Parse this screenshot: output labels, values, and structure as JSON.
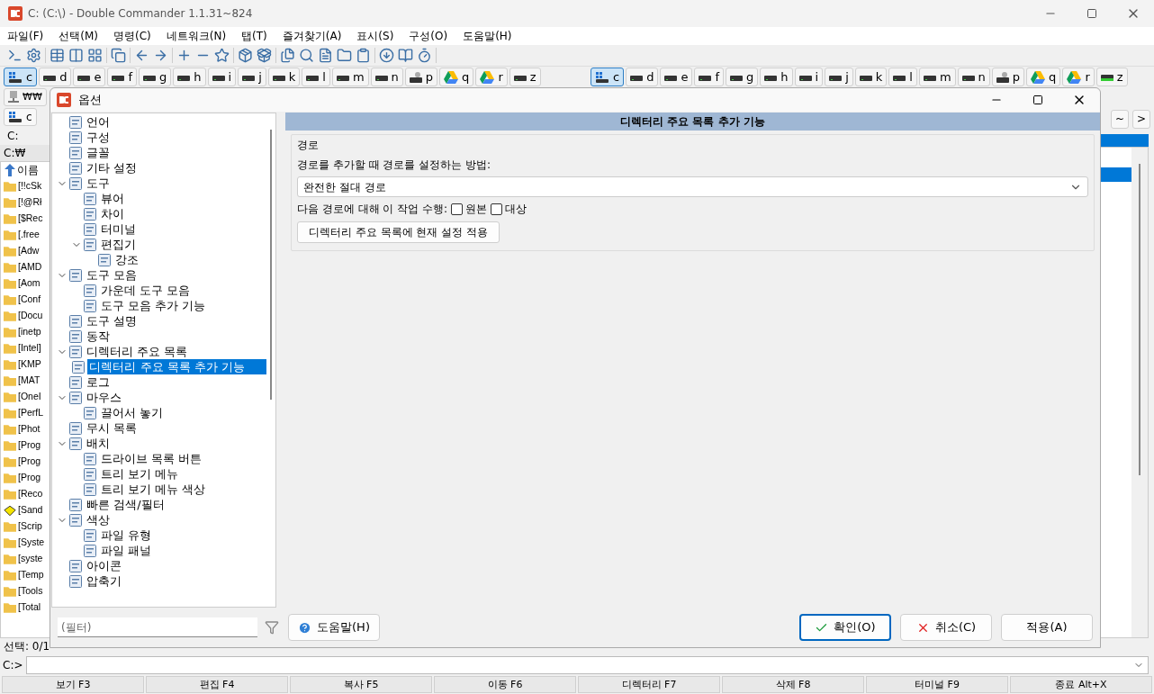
{
  "window": {
    "title": "C: (C:\\) - Double Commander 1.1.31~824"
  },
  "menu": [
    "파일(F)",
    "선택(M)",
    "명령(C)",
    "네트워크(N)",
    "탭(T)",
    "즐겨찾기(A)",
    "표시(S)",
    "구성(O)",
    "도움말(H)"
  ],
  "drives_left": [
    {
      "label": "c",
      "kind": "system",
      "selected": true
    },
    {
      "label": "d",
      "kind": "disk",
      "selected": false
    },
    {
      "label": "e",
      "kind": "disk",
      "selected": false
    },
    {
      "label": "f",
      "kind": "disk",
      "selected": false
    },
    {
      "label": "g",
      "kind": "disk",
      "selected": false
    },
    {
      "label": "h",
      "kind": "disk",
      "selected": false
    },
    {
      "label": "i",
      "kind": "disk",
      "selected": false
    },
    {
      "label": "j",
      "kind": "disk",
      "selected": false
    },
    {
      "label": "k",
      "kind": "disk",
      "selected": false
    },
    {
      "label": "l",
      "kind": "disk",
      "selected": false
    },
    {
      "label": "m",
      "kind": "disk",
      "selected": false
    },
    {
      "label": "n",
      "kind": "disk",
      "selected": false
    },
    {
      "label": "p",
      "kind": "network",
      "selected": false
    },
    {
      "label": "q",
      "kind": "cloud",
      "selected": false
    },
    {
      "label": "r",
      "kind": "cloud",
      "selected": false
    },
    {
      "label": "z",
      "kind": "disk",
      "selected": false
    }
  ],
  "drives_right": [
    {
      "label": "c",
      "kind": "system",
      "selected": true
    },
    {
      "label": "d",
      "kind": "disk",
      "selected": false
    },
    {
      "label": "e",
      "kind": "disk",
      "selected": false
    },
    {
      "label": "f",
      "kind": "disk",
      "selected": false
    },
    {
      "label": "g",
      "kind": "disk",
      "selected": false
    },
    {
      "label": "h",
      "kind": "disk",
      "selected": false
    },
    {
      "label": "i",
      "kind": "disk",
      "selected": false
    },
    {
      "label": "j",
      "kind": "disk",
      "selected": false
    },
    {
      "label": "k",
      "kind": "disk",
      "selected": false
    },
    {
      "label": "l",
      "kind": "disk",
      "selected": false
    },
    {
      "label": "m",
      "kind": "disk",
      "selected": false
    },
    {
      "label": "n",
      "kind": "disk",
      "selected": false
    },
    {
      "label": "p",
      "kind": "network",
      "selected": false
    },
    {
      "label": "q",
      "kind": "cloud",
      "selected": false
    },
    {
      "label": "r",
      "kind": "cloud",
      "selected": false
    },
    {
      "label": "z",
      "kind": "usb",
      "selected": false
    }
  ],
  "left_panel": {
    "network_button": "₩₩",
    "tab": "c",
    "path": "C:",
    "current_dir": "C:₩",
    "column": "이름",
    "files": [
      {
        "name": "[!!cSk",
        "kind": "folder"
      },
      {
        "name": "[!@Rł",
        "kind": "folder"
      },
      {
        "name": "[$Rec",
        "kind": "folder"
      },
      {
        "name": "[.free",
        "kind": "folder"
      },
      {
        "name": "[Adw",
        "kind": "folder"
      },
      {
        "name": "[AMD",
        "kind": "folder"
      },
      {
        "name": "[Aom",
        "kind": "folder"
      },
      {
        "name": "[Conf",
        "kind": "folder"
      },
      {
        "name": "[Docu",
        "kind": "folder"
      },
      {
        "name": "[inetp",
        "kind": "folder"
      },
      {
        "name": "[Intel]",
        "kind": "folder"
      },
      {
        "name": "[KMP",
        "kind": "folder"
      },
      {
        "name": "[MAT",
        "kind": "folder"
      },
      {
        "name": "[OneI",
        "kind": "folder"
      },
      {
        "name": "[PerfL",
        "kind": "folder"
      },
      {
        "name": "[Phot",
        "kind": "folder"
      },
      {
        "name": "[Prog",
        "kind": "folder"
      },
      {
        "name": "[Prog",
        "kind": "folder"
      },
      {
        "name": "[Prog",
        "kind": "folder"
      },
      {
        "name": "[Reco",
        "kind": "folder"
      },
      {
        "name": "[Sand",
        "kind": "special"
      },
      {
        "name": "[Scrip",
        "kind": "folder"
      },
      {
        "name": "[Syste",
        "kind": "folder"
      },
      {
        "name": "[syste",
        "kind": "folder"
      },
      {
        "name": "[Temp",
        "kind": "folder"
      },
      {
        "name": "[Tools",
        "kind": "folder"
      },
      {
        "name": "[Total",
        "kind": "folder"
      }
    ],
    "status": "선택: 0/1"
  },
  "right_panel": {
    "buttons": [
      "~",
      ">"
    ]
  },
  "command_line": {
    "prompt": "C:>"
  },
  "function_keys": [
    "보기 F3",
    "편집 F4",
    "복사 F5",
    "이동 F6",
    "디렉터리 F7",
    "삭제 F8",
    "터미널 F9",
    "종료 Alt+X"
  ],
  "dialog": {
    "title": "옵션",
    "tree": [
      {
        "label": "언어",
        "selected": false
      },
      {
        "label": "구성",
        "selected": false
      },
      {
        "label": "글꼴",
        "selected": false
      },
      {
        "label": "기타 설정",
        "selected": false
      },
      {
        "label": "도구",
        "selected": false,
        "expanded": true,
        "children": [
          {
            "label": "뷰어",
            "selected": false
          },
          {
            "label": "차이",
            "selected": false
          },
          {
            "label": "터미널",
            "selected": false
          },
          {
            "label": "편집기",
            "selected": false,
            "expanded": true,
            "children": [
              {
                "label": "강조",
                "selected": false
              }
            ]
          }
        ]
      },
      {
        "label": "도구 모음",
        "selected": false,
        "expanded": true,
        "children": [
          {
            "label": "가운데 도구 모음",
            "selected": false
          },
          {
            "label": "도구 모음 추가 기능",
            "selected": false
          }
        ]
      },
      {
        "label": "도구 설명",
        "selected": false
      },
      {
        "label": "동작",
        "selected": false
      },
      {
        "label": "디렉터리 주요 목록",
        "selected": false,
        "expanded": true,
        "children": [
          {
            "label": "디렉터리 주요 목록 추가 기능",
            "selected": true
          }
        ]
      },
      {
        "label": "로그",
        "selected": false
      },
      {
        "label": "마우스",
        "selected": false,
        "expanded": true,
        "children": [
          {
            "label": "끌어서 놓기",
            "selected": false
          }
        ]
      },
      {
        "label": "무시 목록",
        "selected": false
      },
      {
        "label": "배치",
        "selected": false,
        "expanded": true,
        "children": [
          {
            "label": "드라이브 목록 버튼",
            "selected": false
          },
          {
            "label": "트리 보기 메뉴",
            "selected": false
          },
          {
            "label": "트리 보기 메뉴 색상",
            "selected": false
          }
        ]
      },
      {
        "label": "빠른 검색/필터",
        "selected": false
      },
      {
        "label": "색상",
        "selected": false,
        "expanded": true,
        "children": [
          {
            "label": "파일 유형",
            "selected": false
          },
          {
            "label": "파일 패널",
            "selected": false
          }
        ]
      },
      {
        "label": "아이콘",
        "selected": false
      },
      {
        "label": "압축기",
        "selected": false
      }
    ],
    "filter": {
      "placeholder": "(필터)"
    },
    "page_title": "디렉터리 주요 목록 추가 기능",
    "group": {
      "title": "경로",
      "path_label": "경로를 추가할 때 경로를 설정하는 방법:",
      "path_mode": "완전한 절대 경로",
      "apply_label": "다음 경로에 대해 이 작업 수행:",
      "targets": [
        {
          "label": "원본",
          "checked": false
        },
        {
          "label": "대상",
          "checked": false
        }
      ],
      "apply_button": "디렉터리 주요 목록에 현재 설정 적용"
    },
    "buttons": [
      {
        "label": "도움말(H)",
        "kind": "help",
        "default": false
      },
      {
        "label": "확인(O)",
        "kind": "ok",
        "default": true
      },
      {
        "label": "취소(C)",
        "kind": "cancel",
        "default": false
      },
      {
        "label": "적용(A)",
        "kind": "apply",
        "default": false
      }
    ]
  }
}
